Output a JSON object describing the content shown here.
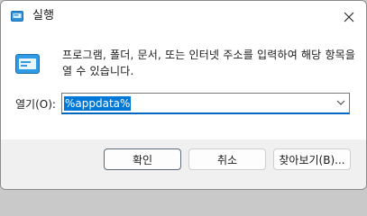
{
  "window": {
    "title": "실행",
    "close_icon": "close-icon"
  },
  "description": "프로그램, 폴더, 문서, 또는 인터넷 주소를 입력하여 해당 항목을 열 수 있습니다.",
  "open_field": {
    "label": "열기(O):",
    "value": "%appdata%",
    "dropdown_icon": "chevron-down-icon"
  },
  "buttons": {
    "ok": "확인",
    "cancel": "취소",
    "browse": "찾아보기(B)..."
  },
  "colors": {
    "accent": "#0067c0",
    "selection": "#0078d7"
  }
}
